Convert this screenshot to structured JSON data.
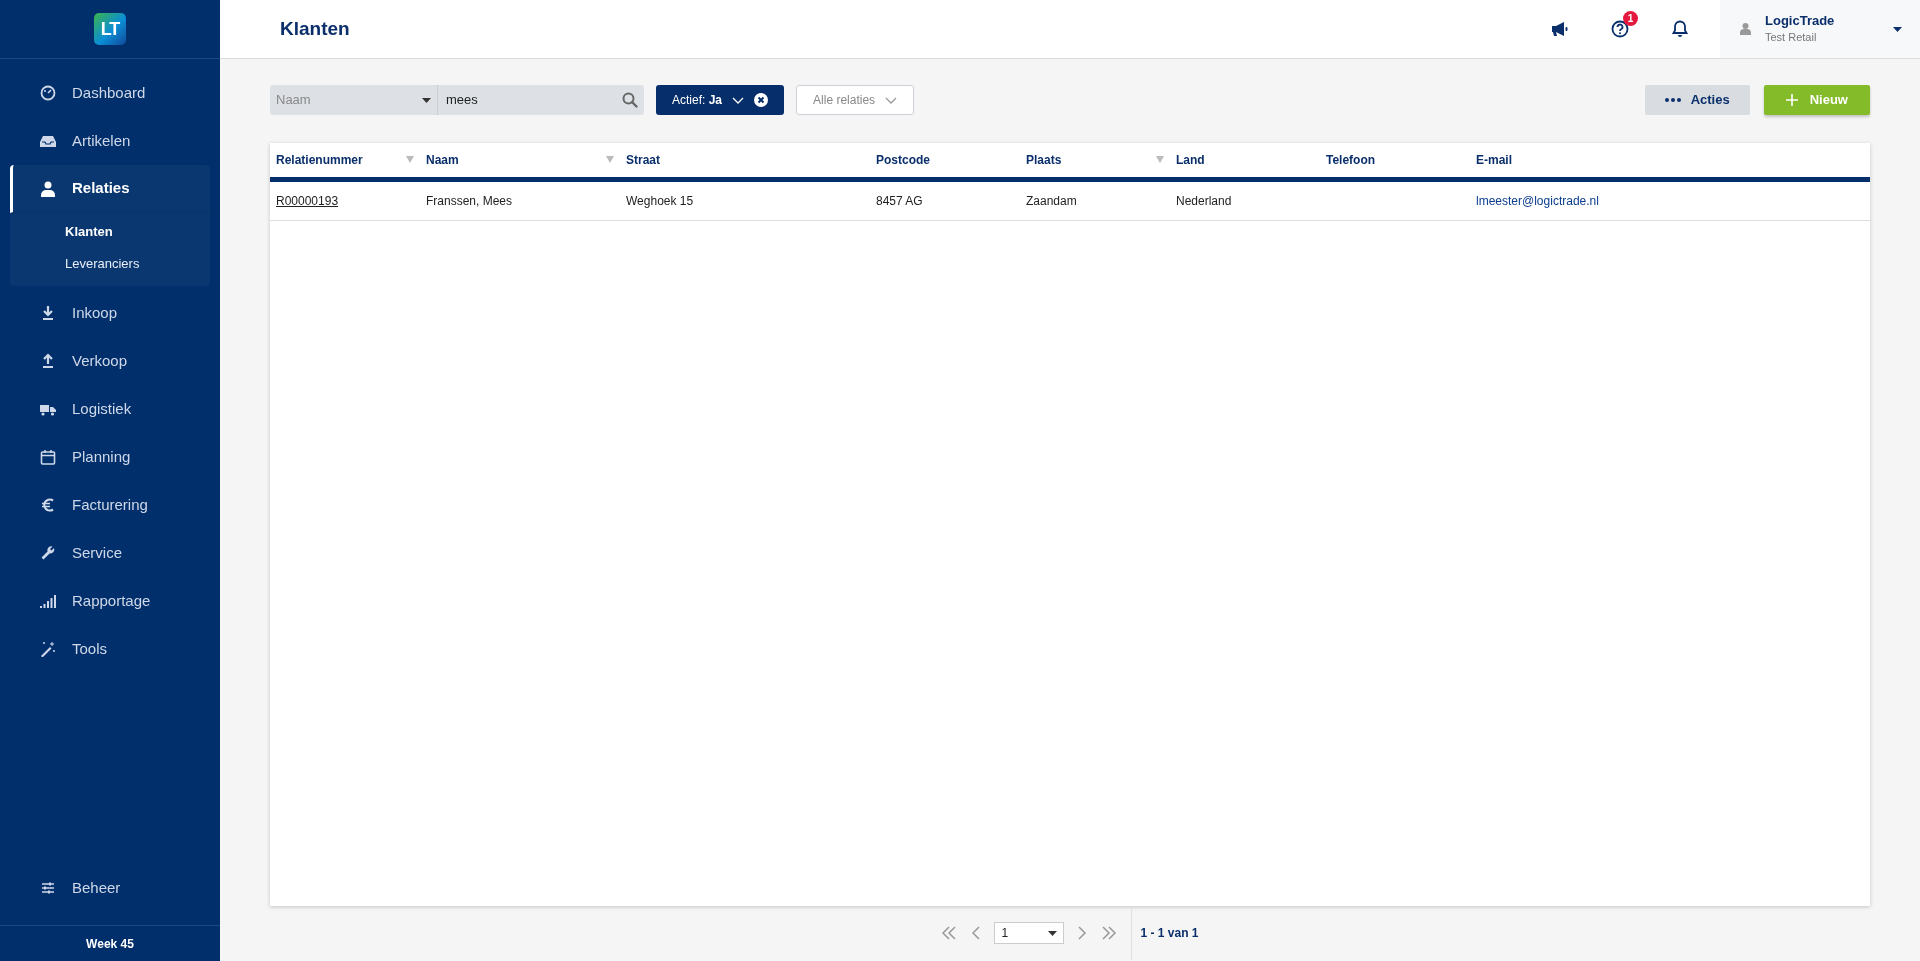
{
  "logo": {
    "text": "LT"
  },
  "sidebar": {
    "items": [
      {
        "label": "Dashboard",
        "selected": false,
        "expanded": false
      },
      {
        "label": "Artikelen",
        "selected": false,
        "expanded": false
      },
      {
        "label": "Relaties",
        "selected": true,
        "expanded": true,
        "children": [
          {
            "label": "Klanten",
            "selected": true
          },
          {
            "label": "Leveranciers",
            "selected": false
          }
        ]
      },
      {
        "label": "Inkoop",
        "selected": false,
        "expanded": false
      },
      {
        "label": "Verkoop",
        "selected": false,
        "expanded": false
      },
      {
        "label": "Logistiek",
        "selected": false,
        "expanded": false
      },
      {
        "label": "Planning",
        "selected": false,
        "expanded": false
      },
      {
        "label": "Facturering",
        "selected": false,
        "expanded": false
      },
      {
        "label": "Service",
        "selected": false,
        "expanded": false
      },
      {
        "label": "Rapportage",
        "selected": false,
        "expanded": false
      },
      {
        "label": "Tools",
        "selected": false,
        "expanded": false
      }
    ],
    "bottom_item": {
      "label": "Beheer"
    },
    "footer": "Week 45"
  },
  "header": {
    "title": "Klanten",
    "help_badge": "1",
    "user": {
      "name": "LogicTrade",
      "company": "Test Retail"
    }
  },
  "toolbar": {
    "search_field_select": "Naam",
    "search_value": "mees",
    "active_filter": "Actief: **Ja**",
    "relation_filter": "Alle relaties",
    "actions_button": "Acties",
    "new_button": "Nieuw"
  },
  "table": {
    "columns": [
      {
        "label": "Relatienummer",
        "filter": true
      },
      {
        "label": "Naam",
        "filter": true
      },
      {
        "label": "Straat",
        "filter": false
      },
      {
        "label": "Postcode",
        "filter": false
      },
      {
        "label": "Plaats",
        "filter": true
      },
      {
        "label": "Land",
        "filter": false
      },
      {
        "label": "Telefoon",
        "filter": false
      },
      {
        "label": "E-mail",
        "filter": false
      }
    ],
    "rows": [
      {
        "cells": [
          {
            "kind": "link",
            "text": "R00000193"
          },
          {
            "kind": "text",
            "text": "Franssen, Mees"
          },
          {
            "kind": "text",
            "text": "Weghoek 15"
          },
          {
            "kind": "text",
            "text": "8457 AG"
          },
          {
            "kind": "text",
            "text": "Zaandam"
          },
          {
            "kind": "text",
            "text": "Nederland"
          },
          {
            "kind": "empty"
          },
          {
            "kind": "email",
            "text": "lmeester@logictrade.nl"
          }
        ]
      }
    ]
  },
  "pagination": {
    "page": "1",
    "summary": "1 - 1 van 1"
  }
}
